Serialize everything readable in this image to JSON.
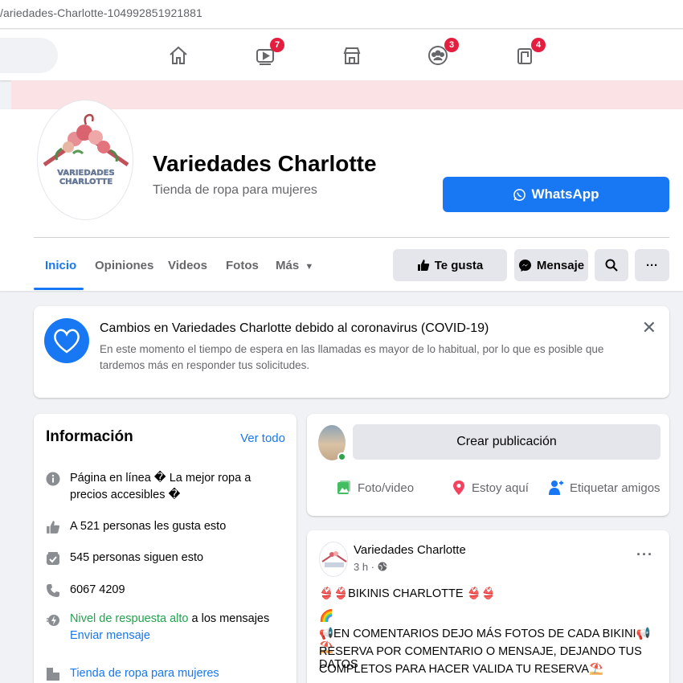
{
  "browser": {
    "url": "/ariedades-Charlotte-104992851921881"
  },
  "topnav": {
    "badges": {
      "watch": "7",
      "groups": "3",
      "gaming": "4"
    },
    "icons": [
      "home-icon",
      "watch-icon",
      "marketplace-icon",
      "groups-icon",
      "gaming-icon"
    ]
  },
  "page": {
    "name": "Variedades Charlotte",
    "category": "Tienda de ropa para mujeres",
    "logo_text_line1": "VARIEDADES",
    "logo_text_line2": "CHARLOTTE",
    "whatsapp_label": "WhatsApp"
  },
  "tabs": [
    {
      "label": "Inicio"
    },
    {
      "label": "Opiniones"
    },
    {
      "label": "Videos"
    },
    {
      "label": "Fotos"
    },
    {
      "label": "Más"
    }
  ],
  "actions": {
    "like": "Te gusta",
    "message": "Mensaje",
    "more": "···"
  },
  "covid": {
    "title": "Cambios en Variedades Charlotte debido al coronavirus (COVID-19)",
    "body": "En este momento el tiempo de espera en las llamadas es mayor de lo habitual, por lo que es posible que tardemos más en responder tus solicitudes.",
    "close": "✕"
  },
  "info": {
    "title": "Información",
    "see_all": "Ver todo",
    "about": "Página en línea � La mejor ropa a precios accesibles �",
    "likes": "A 521 personas les gusta esto",
    "followers": "545 personas siguen esto",
    "phone": "6067 4209",
    "response_highlight": "Nivel de respuesta alto",
    "response_rest": " a los mensajes",
    "send_message": "Enviar mensaje",
    "category_link": "Tienda de ropa para mujeres"
  },
  "create_post": {
    "button": "Crear publicación",
    "photo_video": "Foto/video",
    "checkin": "Estoy aquí",
    "tag_friends": "Etiquetar amigos"
  },
  "post": {
    "author": "Variedades Charlotte",
    "time": "3 h · ",
    "line1": "👙👙BIKINIS CHARLOTTE 👙👙",
    "line2": "🌈",
    "line3": "📢EN COMENTARIOS DEJO MÁS FOTOS DE CADA BIKINI📢⛱️",
    "line4": "RESERVA POR COMENTARIO O MENSAJE, DEJANDO TUS DATOS",
    "line5": "COMPLETOS PARA HACER VALIDA TU RESERVA⛱️",
    "more": "···"
  },
  "colors": {
    "accent": "#1877f2",
    "badge": "#e41e3f",
    "green": "#20a34e",
    "banner_pink": "#fbe2e4"
  }
}
